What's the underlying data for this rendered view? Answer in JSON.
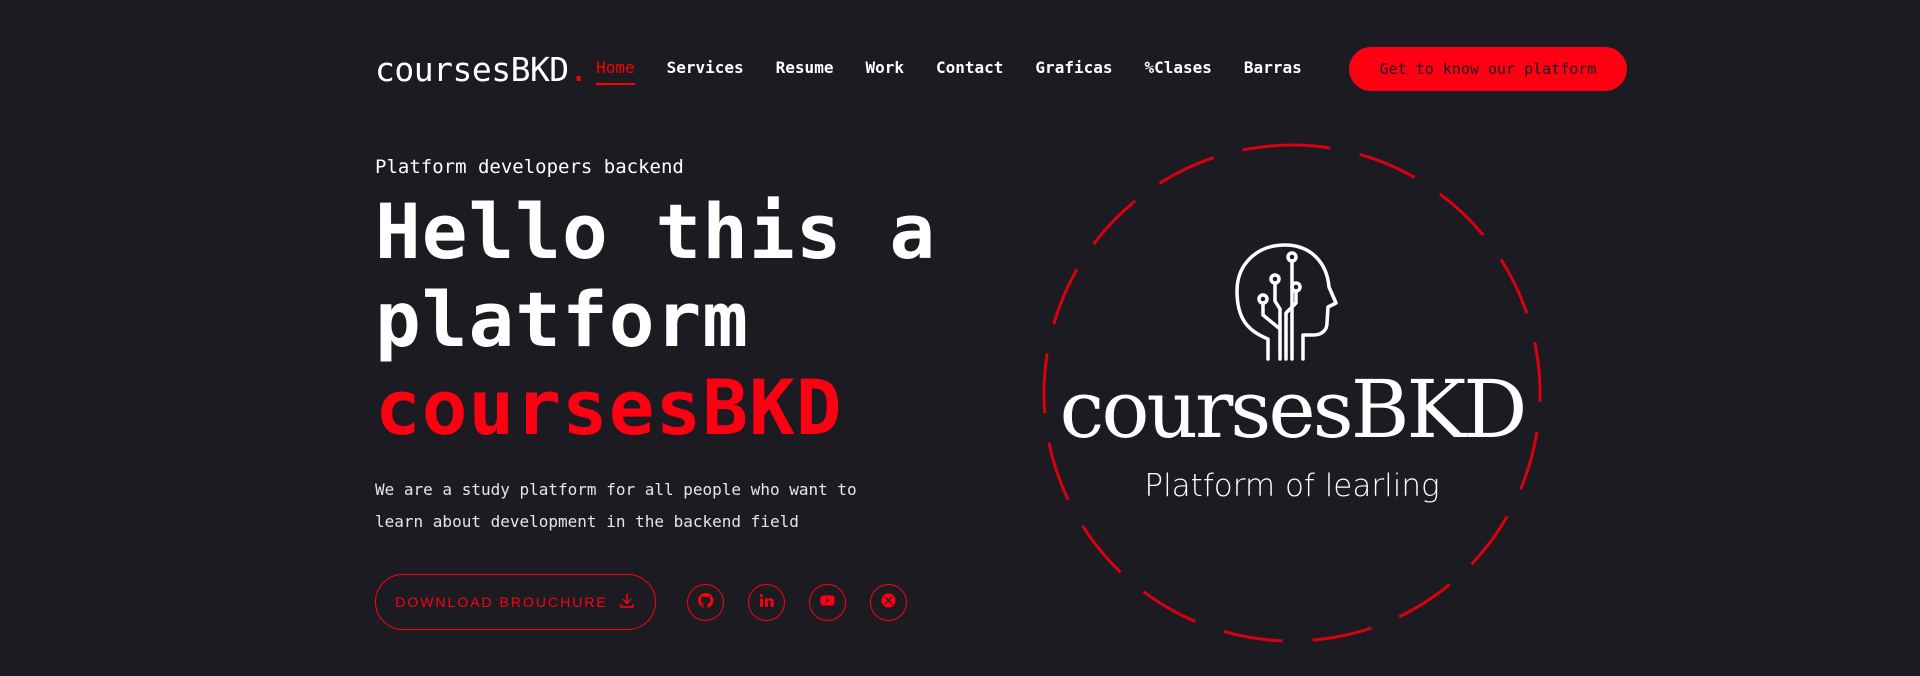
{
  "header": {
    "logo_text": "coursesBKD",
    "logo_dot": ".",
    "nav": [
      {
        "label": "Home",
        "active": true
      },
      {
        "label": "Services"
      },
      {
        "label": "Resume"
      },
      {
        "label": "Work"
      },
      {
        "label": "Contact"
      },
      {
        "label": "Graficas"
      },
      {
        "label": "%Clases"
      },
      {
        "label": "Barras"
      }
    ],
    "cta_label": "Get to know our platform"
  },
  "hero": {
    "subtitle": "Platform developers backend",
    "headline_line1": "Hello this a",
    "headline_line2": "platform",
    "headline_brand": "coursesBKD",
    "description": "We are a study platform for all people who want to learn about development in the backend field",
    "download_label": "DOWNLOAD BROUCHURE",
    "socials": [
      "github-icon",
      "linkedin-icon",
      "youtube-icon",
      "xbox-icon"
    ]
  },
  "badge": {
    "title": "coursesBKD",
    "subtitle": "Platform of learling"
  },
  "colors": {
    "background": "#1c1b22",
    "accent": "#ff0013",
    "text": "#ffffff"
  }
}
